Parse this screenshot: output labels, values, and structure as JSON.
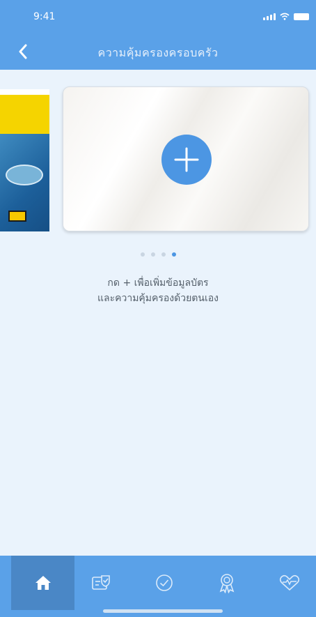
{
  "status_bar": {
    "time": "9:41"
  },
  "header": {
    "title": "ความคุ้มครองครอบครัว",
    "back_icon": "chevron-left-icon"
  },
  "carousel": {
    "add_icon": "plus-icon",
    "page_count": 4,
    "active_index": 3
  },
  "hint": {
    "line1": "กด + เพื่อเพิ่มข้อมูลบัตร",
    "line2": "และความคุ้มครองด้วยตนเอง"
  },
  "tabbar": {
    "tabs": [
      {
        "icon": "home-icon",
        "active": true
      },
      {
        "icon": "card-check-icon",
        "active": false
      },
      {
        "icon": "check-circle-icon",
        "active": false
      },
      {
        "icon": "award-icon",
        "active": false
      },
      {
        "icon": "heart-pulse-icon",
        "active": false
      }
    ]
  },
  "colors": {
    "primary": "#5aa1e8",
    "accent": "#4c96e3",
    "background": "#eaf3fc"
  }
}
